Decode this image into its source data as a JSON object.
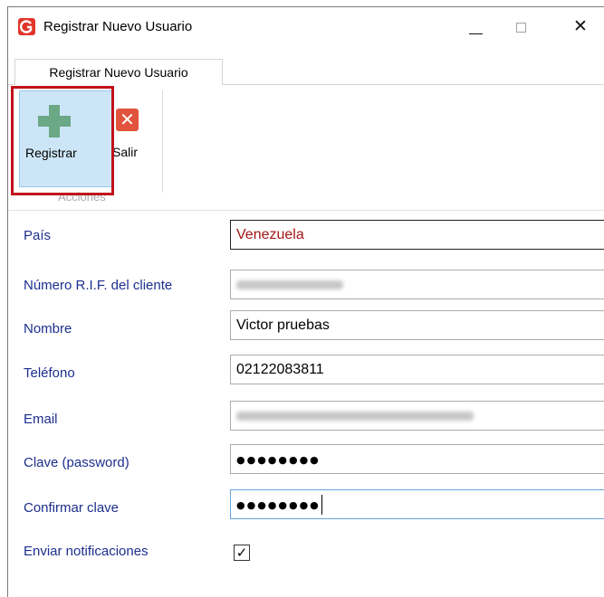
{
  "window": {
    "title": "Registrar Nuevo Usuario",
    "minimize_glyph": "",
    "close_glyph": "✕"
  },
  "ribbon": {
    "tab_label": "Registrar Nuevo Usuario",
    "registrar_label": "Registrar",
    "salir_label": "Salir",
    "salir_glyph": "✕",
    "group_label": "Acciones"
  },
  "form": {
    "pais": {
      "label": "País",
      "value": "Venezuela"
    },
    "rif": {
      "label": "Número R.I.F. del cliente",
      "value": ""
    },
    "nombre": {
      "label": "Nombre",
      "value": "Victor pruebas"
    },
    "telefono": {
      "label": "Teléfono",
      "value": "02122083811"
    },
    "email": {
      "label": "Email",
      "value": ""
    },
    "clave": {
      "label": "Clave (password)",
      "value": "●●●●●●●●"
    },
    "confirmar": {
      "label": "Confirmar clave",
      "value": "●●●●●●●●"
    },
    "notificaciones": {
      "label": "Enviar notificaciones",
      "checked": true,
      "check_glyph": "✓"
    }
  },
  "colors": {
    "label_blue": "#1c2f8d",
    "pais_red": "#a31515",
    "highlight_red": "#c1121c",
    "plus_green": "#6aa886",
    "salir_orange": "#e1533d"
  }
}
